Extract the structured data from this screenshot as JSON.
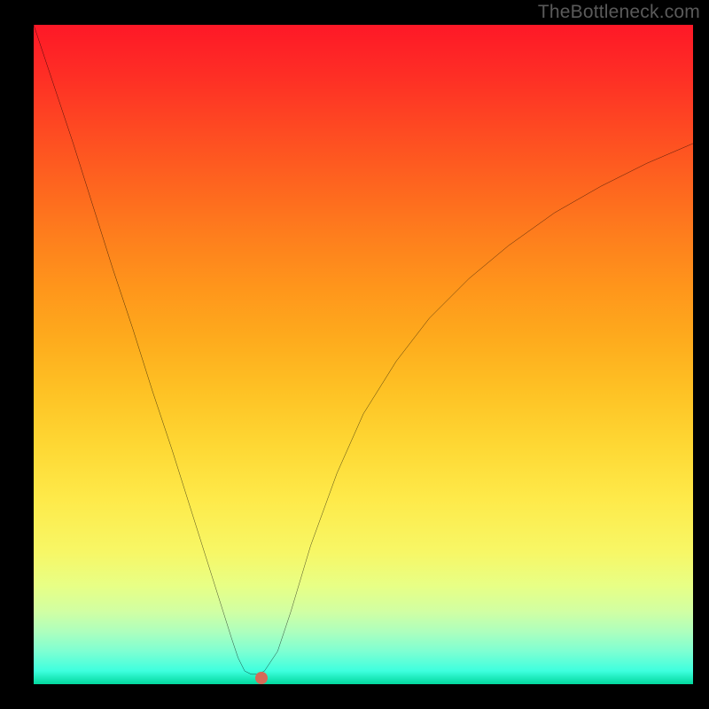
{
  "watermark": "TheBottleneck.com",
  "chart_data": {
    "type": "line",
    "title": "",
    "xlabel": "",
    "ylabel": "",
    "xlim": [
      0,
      100
    ],
    "ylim": [
      0,
      100
    ],
    "axes_visible": false,
    "tick_labels_visible": false,
    "grid": false,
    "background": "rainbow-gradient-vertical",
    "gradient_stops": [
      {
        "pos": 0.0,
        "color": "#fe1827"
      },
      {
        "pos": 0.08,
        "color": "#fe2f25"
      },
      {
        "pos": 0.16,
        "color": "#fe4a22"
      },
      {
        "pos": 0.24,
        "color": "#fe641f"
      },
      {
        "pos": 0.32,
        "color": "#fe7e1d"
      },
      {
        "pos": 0.4,
        "color": "#ff961b"
      },
      {
        "pos": 0.48,
        "color": "#feac1d"
      },
      {
        "pos": 0.56,
        "color": "#fec325"
      },
      {
        "pos": 0.64,
        "color": "#fed834"
      },
      {
        "pos": 0.72,
        "color": "#feea4a"
      },
      {
        "pos": 0.8,
        "color": "#f7f766"
      },
      {
        "pos": 0.85,
        "color": "#e8ff85"
      },
      {
        "pos": 0.89,
        "color": "#d1ffa3"
      },
      {
        "pos": 0.92,
        "color": "#aeffbd"
      },
      {
        "pos": 0.95,
        "color": "#7effd2"
      },
      {
        "pos": 0.98,
        "color": "#3effde"
      },
      {
        "pos": 1.0,
        "color": "#02d89e"
      }
    ],
    "series": [
      {
        "name": "bottleneck-curve",
        "color": "#000000",
        "stroke_width": 2,
        "x": [
          0,
          3,
          6,
          9,
          12,
          15,
          18,
          21,
          24,
          27,
          30,
          31,
          32,
          33,
          34,
          35,
          37,
          39,
          42,
          46,
          50,
          55,
          60,
          66,
          72,
          79,
          86,
          93,
          100
        ],
        "y": [
          100,
          91,
          82,
          72.5,
          63,
          54,
          44.5,
          35.5,
          26,
          16.5,
          7,
          4,
          2,
          1.5,
          1.5,
          2,
          5,
          11,
          21,
          32,
          41,
          49,
          55.5,
          61.5,
          66.5,
          71.5,
          75.5,
          79,
          82
        ]
      }
    ],
    "optimum_marker": {
      "x": 34.5,
      "y": 0.9,
      "color": "#d56a58"
    }
  }
}
